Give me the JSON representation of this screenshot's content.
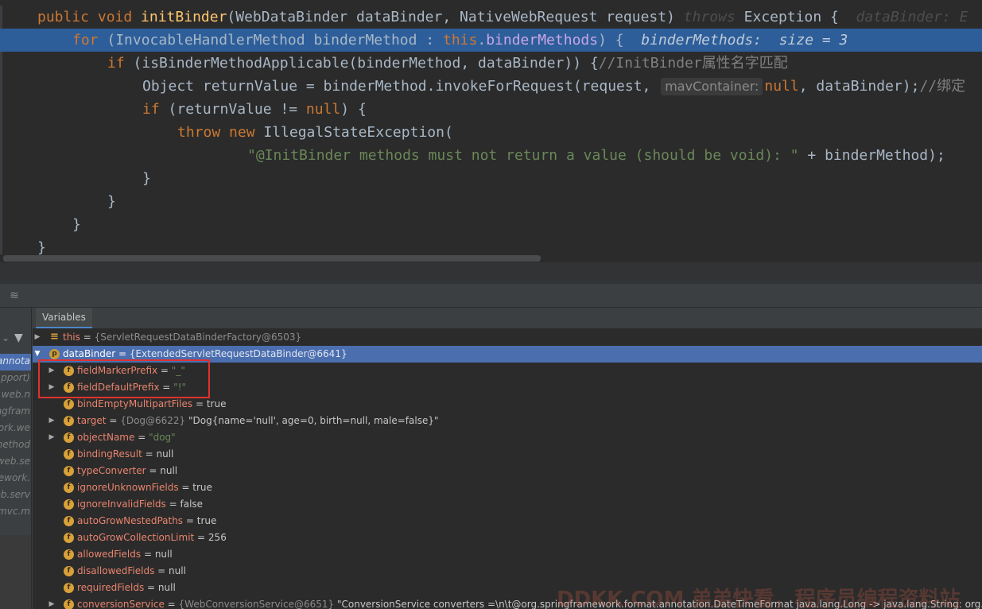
{
  "editor": {
    "lines": [
      {
        "kw1": "public void ",
        "fn": "initBinder",
        "t1": "(WebDataBinder dataBinder, NativeWebRequest request) ",
        "throws": "throws",
        "t2": " Exception {",
        "hint": "dataBinder: E"
      },
      {
        "kw1": "for",
        "t1": " (InvocableHandlerMethod binderMethod : ",
        "kw2": "this",
        "t2": ".",
        "fld": "binderMethods",
        "t3": ") {",
        "hint": "binderMethods:  size = 3"
      },
      {
        "kw1": "if",
        "t1": " (isBinderMethodApplicable(binderMethod, dataBinder)) {",
        "cmt": "//InitBinder属性名字匹配"
      },
      {
        "t1": "Object returnValue = binderMethod.invokeForRequest(request, ",
        "paramhint": "mavContainer:",
        "kw1": "null",
        "t2": ", dataBinder);",
        "cmt": "//绑定"
      },
      {
        "kw1": "if",
        "t1": " (returnValue != ",
        "kw2": "null",
        "t2": ") {"
      },
      {
        "kw1": "throw new ",
        "t1": "IllegalStateException("
      },
      {
        "str": "\"@InitBinder methods must not return a value (should be void): \"",
        "t1": " + binderMethod);"
      },
      {
        "t1": "}"
      },
      {
        "t1": "}"
      },
      {
        "t1": "}"
      },
      {
        "t1": "}"
      }
    ]
  },
  "debugger": {
    "tab_label": "Variables",
    "layout_icon": "layout-icon",
    "frames": [
      {
        "label": "annota",
        "selected": true
      },
      {
        "label": "pport)",
        "selected": false
      },
      {
        "label": "k.web.n",
        "selected": false
      },
      {
        "label": "ngfram",
        "selected": false
      },
      {
        "label": "ork.we",
        "selected": false
      },
      {
        "label": "nethod",
        "selected": false
      },
      {
        "label": "k.web.se",
        "selected": false
      },
      {
        "label": "ework.",
        "selected": false
      },
      {
        "label": "eb.serv",
        "selected": false
      },
      {
        "label": "mvc.m",
        "selected": false
      }
    ],
    "variables": [
      {
        "name": "this",
        "sep": " = ",
        "type": "{ServletRequestDataBinderFactory@6503}",
        "value": ""
      },
      {
        "name": "dataBinder",
        "sep": " = ",
        "type": "{ExtendedServletRequestDataBinder@6641}",
        "value": ""
      },
      {
        "name": "fieldMarkerPrefix",
        "sep": " = ",
        "str": "\"_\""
      },
      {
        "name": "fieldDefaultPrefix",
        "sep": " = ",
        "str": "\"!\""
      },
      {
        "name": "bindEmptyMultipartFiles",
        "sep": " = ",
        "value": "true"
      },
      {
        "name": "target",
        "sep": " = ",
        "type": "{Dog@6622} ",
        "value": "\"Dog{name='null', age=0, birth=null, male=false}\""
      },
      {
        "name": "objectName",
        "sep": " = ",
        "str": "\"dog\""
      },
      {
        "name": "bindingResult",
        "sep": " = ",
        "value": "null"
      },
      {
        "name": "typeConverter",
        "sep": " = ",
        "value": "null"
      },
      {
        "name": "ignoreUnknownFields",
        "sep": " = ",
        "value": "true"
      },
      {
        "name": "ignoreInvalidFields",
        "sep": " = ",
        "value": "false"
      },
      {
        "name": "autoGrowNestedPaths",
        "sep": " = ",
        "value": "true"
      },
      {
        "name": "autoGrowCollectionLimit",
        "sep": " = ",
        "value": "256"
      },
      {
        "name": "allowedFields",
        "sep": " = ",
        "value": "null"
      },
      {
        "name": "disallowedFields",
        "sep": " = ",
        "value": "null"
      },
      {
        "name": "requiredFields",
        "sep": " = ",
        "value": "null"
      },
      {
        "name": "conversionService",
        "sep": " = ",
        "type": "{WebConversionService@6651} ",
        "value": "\"ConversionService converters =\\n\\t@org.springframework.format.annotation.DateTimeFormat java.lang.Long -> java.lang.String: org.sp"
      }
    ]
  },
  "watermark": "DDKK.COM 弟弟快看，程序员编程资料站",
  "colors": {
    "editor_bg": "#2b2b2b",
    "exec_line": "#2d5e9a",
    "keyword": "#cc7832",
    "method": "#ffc66d",
    "field": "#9876aa",
    "string": "#6a8759",
    "selection": "#4b6eaf",
    "highlight_box": "#e0322f"
  }
}
